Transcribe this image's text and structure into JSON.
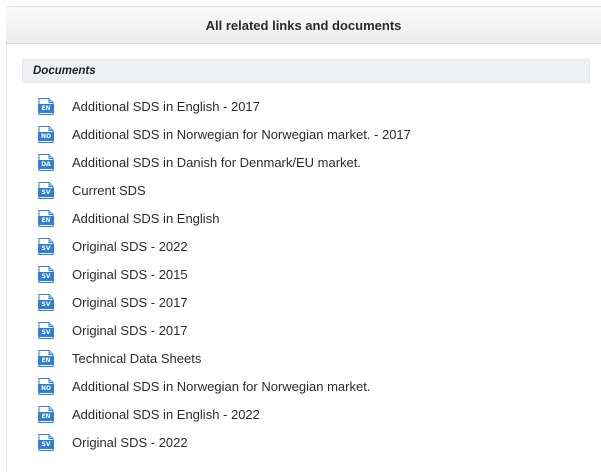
{
  "header": {
    "title": "All related links and documents"
  },
  "section": {
    "title": "Documents"
  },
  "colors": {
    "icon_blue": "#2f7fd3",
    "icon_fold": "#9cc6ef"
  },
  "documents": [
    {
      "lang": "EN",
      "label": "Additional SDS in English - 2017"
    },
    {
      "lang": "NO",
      "label": "Additional SDS in Norwegian for Norwegian market. - 2017"
    },
    {
      "lang": "DA",
      "label": "Additional SDS in Danish for Denmark/EU market."
    },
    {
      "lang": "SV",
      "label": "Current SDS"
    },
    {
      "lang": "EN",
      "label": "Additional SDS in English"
    },
    {
      "lang": "SV",
      "label": "Original SDS - 2022"
    },
    {
      "lang": "SV",
      "label": "Original SDS - 2015"
    },
    {
      "lang": "SV",
      "label": "Original SDS - 2017"
    },
    {
      "lang": "SV",
      "label": "Original SDS - 2017"
    },
    {
      "lang": "EN",
      "label": "Technical Data Sheets"
    },
    {
      "lang": "NO",
      "label": "Additional SDS in Norwegian for Norwegian market."
    },
    {
      "lang": "EN",
      "label": "Additional SDS in English - 2022"
    },
    {
      "lang": "SV",
      "label": "Original SDS - 2022"
    }
  ]
}
